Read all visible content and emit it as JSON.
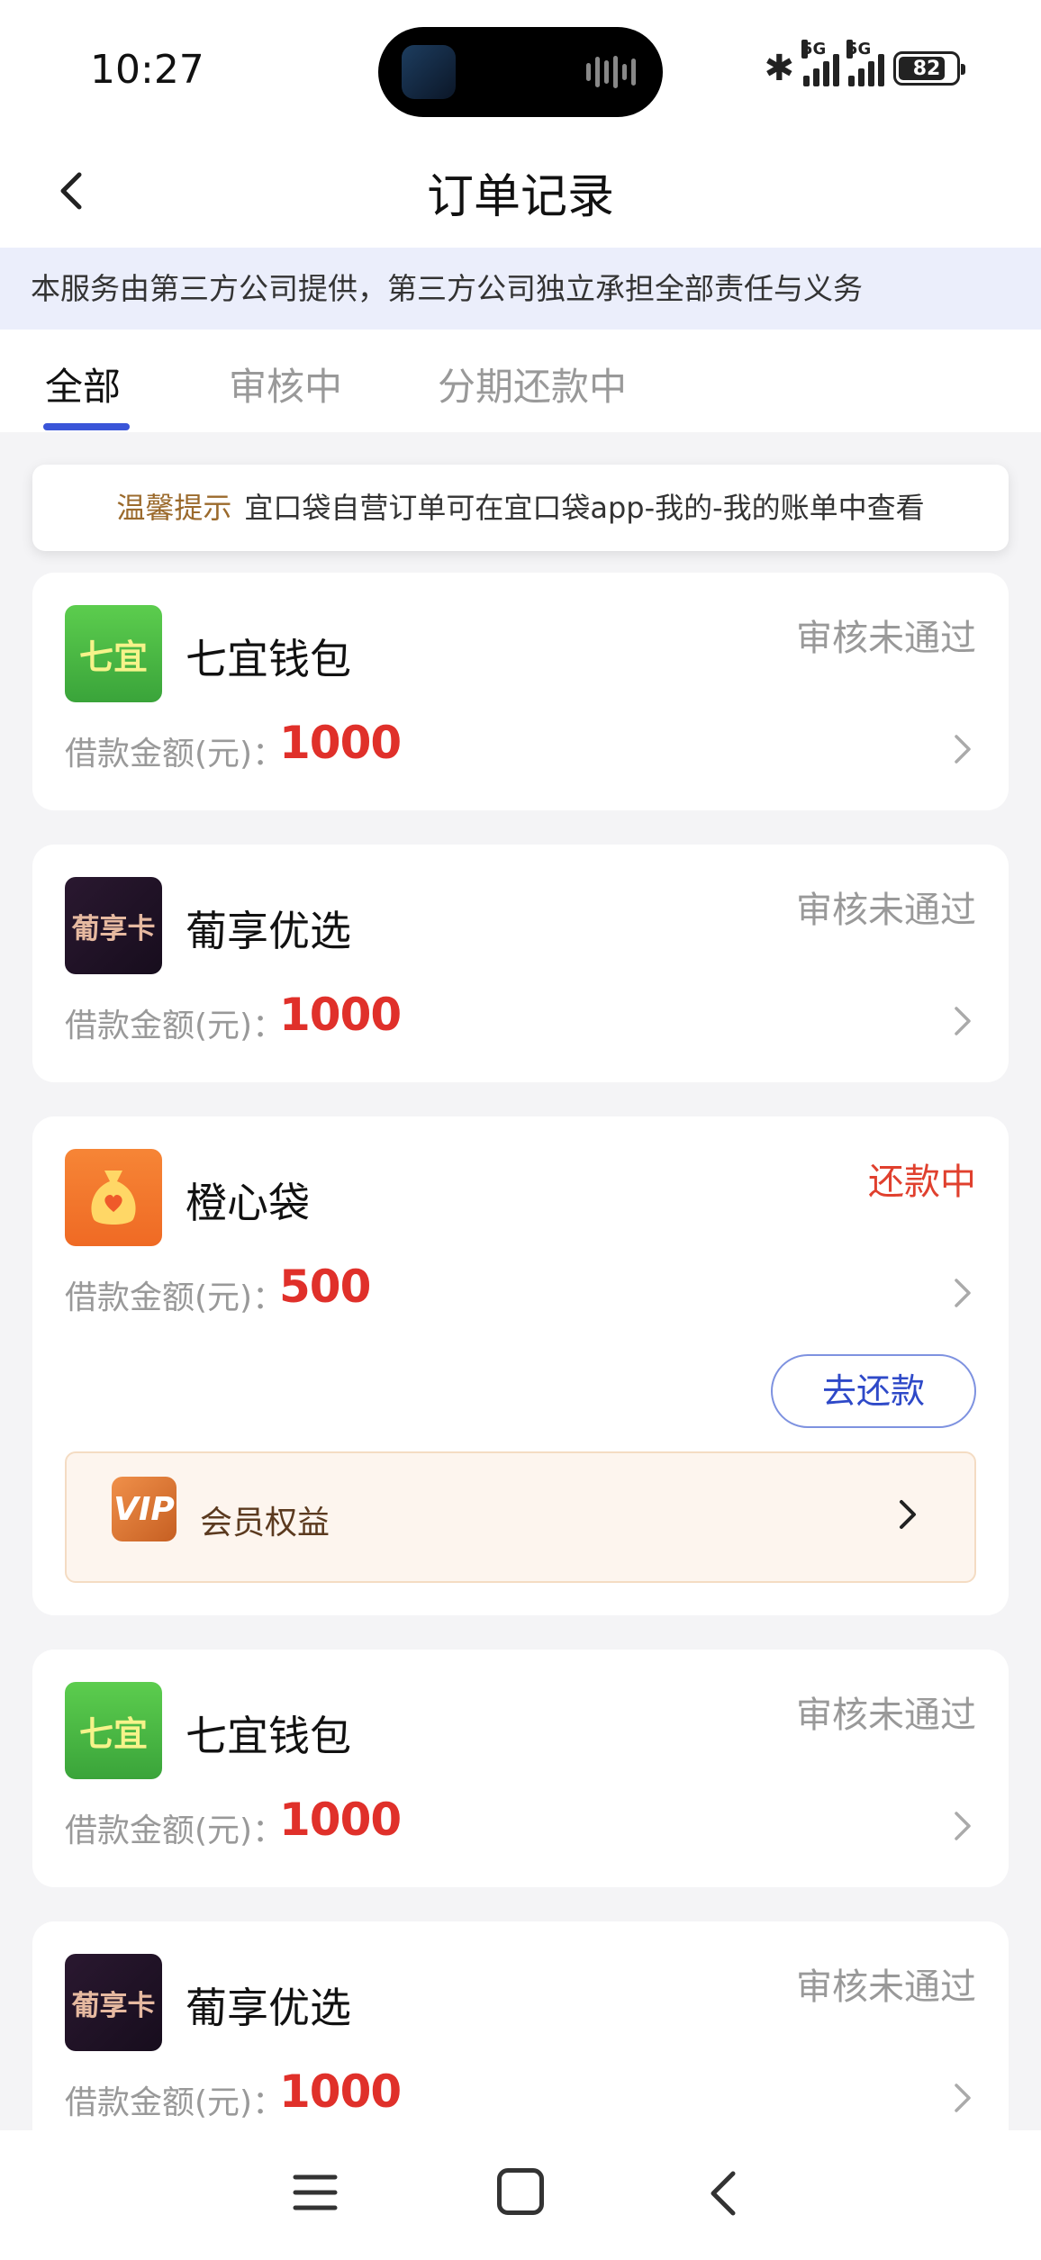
{
  "status_bar": {
    "time": "10:27",
    "network_1": "5G",
    "network_2": "5G",
    "battery": "82",
    "battery_level": 0.82
  },
  "nav": {
    "title": "订单记录"
  },
  "notice": {
    "text": "本服务由第三方公司提供，第三方公司独立承担全部责任与义务"
  },
  "tabs": [
    {
      "label": "全部",
      "active": true
    },
    {
      "label": "审核中",
      "active": false
    },
    {
      "label": "分期还款中",
      "active": false
    }
  ],
  "tip": {
    "label": "温馨提示",
    "text": "宜口袋自营订单可在宜口袋app-我的-我的账单中查看"
  },
  "common": {
    "amount_label": "借款金额(元)："
  },
  "orders": [
    {
      "logo_text": "七宜",
      "name": "七宜钱包",
      "status": "审核未通过",
      "amount": "1000"
    },
    {
      "logo_text": "葡享卡",
      "name": "葡享优选",
      "status": "审核未通过",
      "amount": "1000"
    },
    {
      "logo_text": "",
      "name": "橙心袋",
      "status": "还款中",
      "amount": "500",
      "repay_label": "去还款",
      "vip_icon": "VIP",
      "vip_label": "会员权益"
    },
    {
      "logo_text": "七宜",
      "name": "七宜钱包",
      "status": "审核未通过",
      "amount": "1000"
    },
    {
      "logo_text": "葡享卡",
      "name": "葡享优选",
      "status": "审核未通过",
      "amount": "1000"
    }
  ],
  "colors": {
    "accent": "#3a55d8",
    "amount_red": "#e0302a",
    "status_red": "#e0402e",
    "status_gray": "#999999"
  }
}
